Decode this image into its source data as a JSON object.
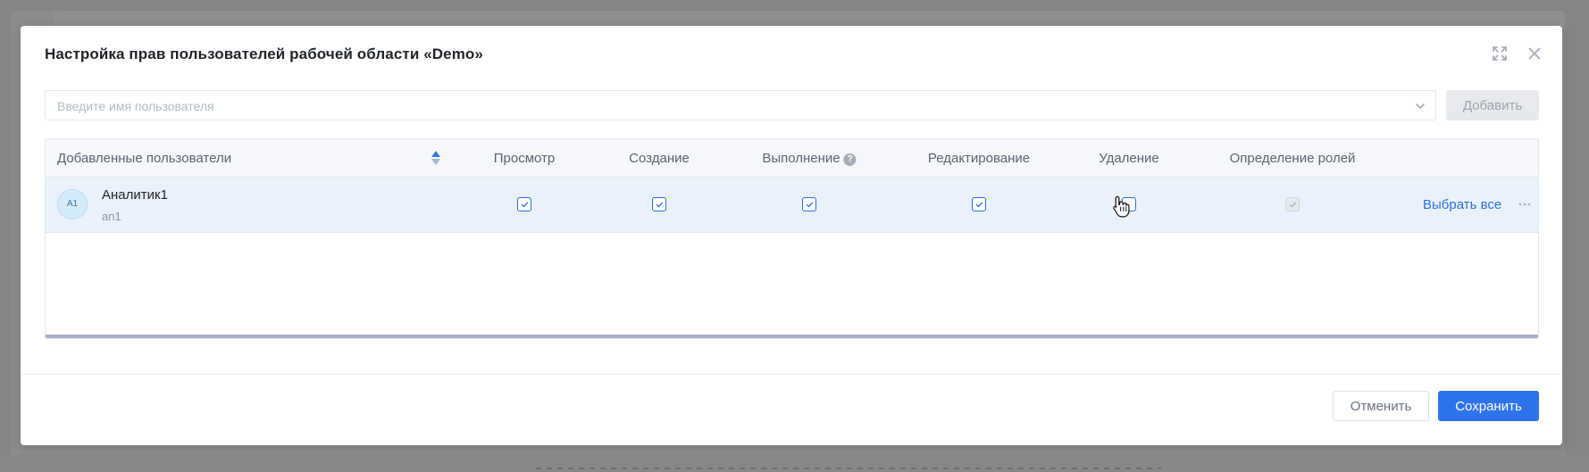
{
  "dialog": {
    "title": "Настройка прав пользователей рабочей области «Demo»"
  },
  "search": {
    "placeholder": "Введите имя пользователя",
    "add_label": "Добавить"
  },
  "table": {
    "columns": {
      "users": "Добавленные пользователи",
      "view": "Просмотр",
      "create": "Создание",
      "execute": "Выполнение",
      "execute_help": "?",
      "edit": "Редактирование",
      "delete": "Удаление",
      "roles": "Определение ролей"
    },
    "rows": [
      {
        "initials": "A1",
        "name": "Аналитик1",
        "login": "an1",
        "permissions": {
          "view": true,
          "create": true,
          "execute": true,
          "edit": true,
          "delete": false,
          "roles": "checked-disabled"
        },
        "select_all": "Выбрать все"
      }
    ]
  },
  "footer": {
    "cancel_label": "Отменить",
    "save_label": "Сохранить"
  },
  "colors": {
    "accent": "#2f73ec",
    "link": "#2f6fe0",
    "row_selected": "#eaf1fb"
  },
  "icons": {
    "expand": "expand-icon",
    "close": "close-icon",
    "dropdown": "chevron-down-icon",
    "sort": "sort-icon",
    "help": "help-icon",
    "check": "check-icon",
    "more": "more-horizontal-icon",
    "pointer": "hand-pointer-icon"
  }
}
